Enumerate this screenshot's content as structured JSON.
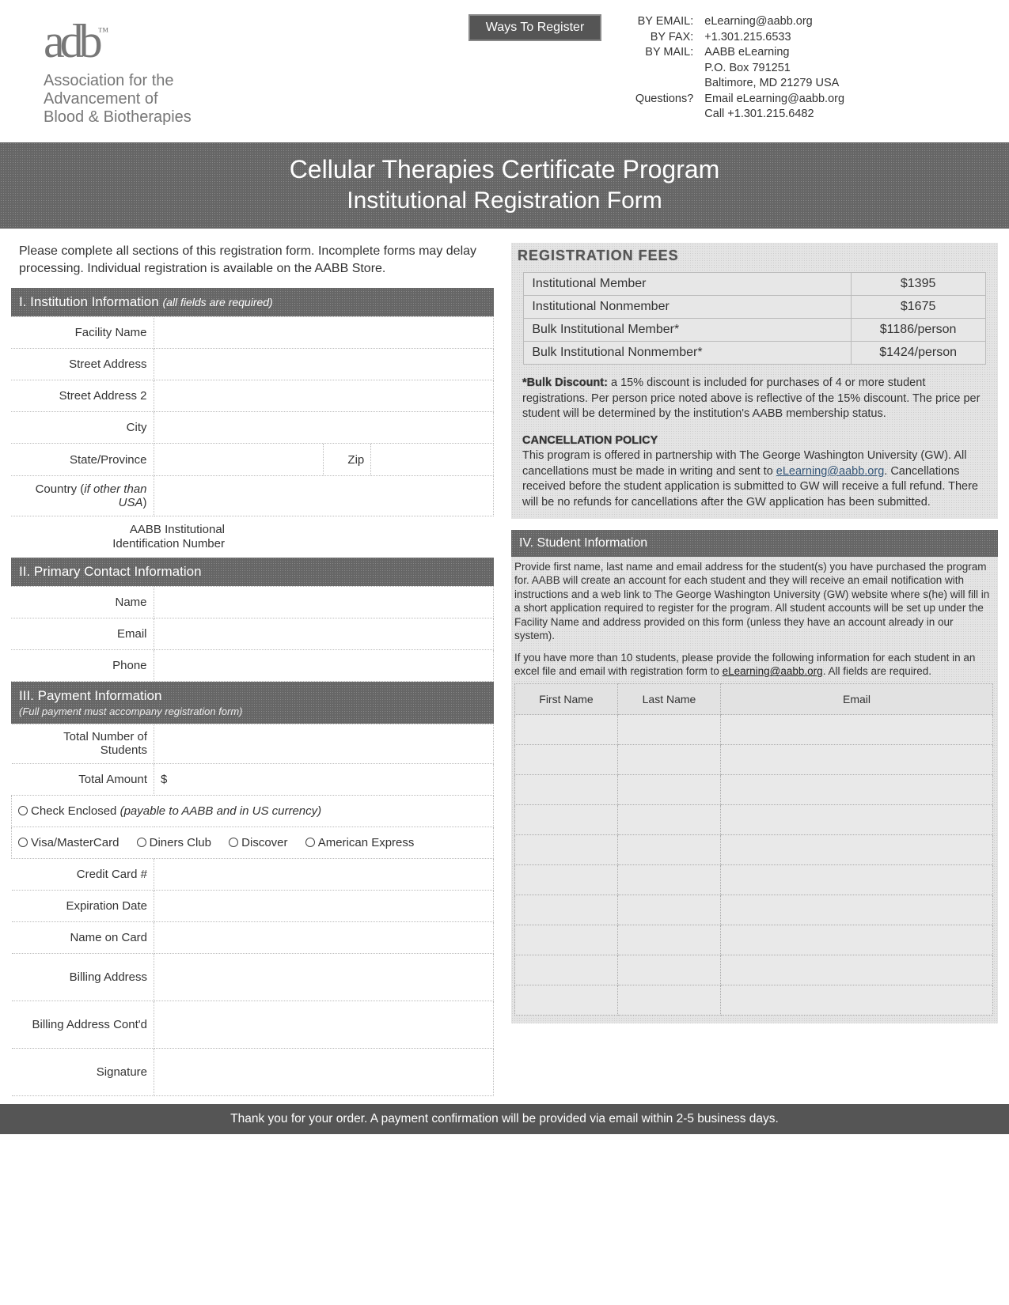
{
  "header": {
    "org_line1": "Association for the",
    "org_line2": "Advancement of",
    "org_line3": "Blood & Biotherapies",
    "ways_btn": "Ways To Register",
    "contact": {
      "email_lbl": "BY EMAIL:",
      "email_val": "eLearning@aabb.org",
      "fax_lbl": "BY FAX:",
      "fax_val": "+1.301.215.6533",
      "mail_lbl": "BY MAIL:",
      "mail_val1": "AABB eLearning",
      "mail_val2": "P.O. Box 791251",
      "mail_val3": "Baltimore, MD 21279 USA",
      "q_lbl": "Questions?",
      "q_val1": "Email eLearning@aabb.org",
      "q_val2": "Call +1.301.215.6482"
    }
  },
  "title": {
    "line1": "Cellular Therapies Certificate Program",
    "line2": "Institutional Registration Form"
  },
  "intro": "Please complete all sections of this registration form. Incomplete forms may delay processing. Individual registration is available on the AABB Store.",
  "sec1": {
    "head": "I. Institution Information",
    "head_note": "(all fields are required)",
    "labels": {
      "facility": "Facility Name",
      "street1": "Street Address",
      "street2": "Street Address 2",
      "city": "City",
      "state": "State/Province",
      "zip": "Zip",
      "country": "Country (if other than USA)",
      "aabb_id": "AABB Institutional Identification Number"
    }
  },
  "sec2": {
    "head": "II. Primary Contact Information",
    "labels": {
      "name": "Name",
      "email": "Email",
      "phone": "Phone"
    }
  },
  "sec3": {
    "head": "III. Payment Information",
    "sub": "(Full payment must accompany registration form)",
    "labels": {
      "total_students": "Total Number of Students",
      "total_amount": "Total Amount",
      "amount_prefix": "$",
      "check": "Check Enclosed",
      "check_note": "(payable to AABB and in US currency)",
      "visa": "Visa/MasterCard",
      "diners": "Diners Club",
      "discover": "Discover",
      "amex": "American Express",
      "cc": "Credit Card #",
      "exp": "Expiration Date",
      "name_on_card": "Name on Card",
      "billing": "Billing Address",
      "billing2": "Billing Address Cont'd",
      "sig": "Signature"
    }
  },
  "fees": {
    "head": "REGISTRATION FEES",
    "rows": [
      {
        "label": "Institutional Member",
        "amount": "$1395"
      },
      {
        "label": "Institutional Nonmember",
        "amount": "$1675"
      },
      {
        "label": "Bulk Institutional Member*",
        "amount": "$1186/person"
      },
      {
        "label": "Bulk Institutional Nonmember*",
        "amount": "$1424/person"
      }
    ],
    "bulk_head": "*Bulk Discount:",
    "bulk_text": " a 15% discount is included for purchases of 4 or more student registrations. Per person price noted above is reflective of the 15% discount. The price per student will be determined by the institution's AABB membership status.",
    "cancel_head": "CANCELLATION POLICY",
    "cancel_text_a": "This program is offered in partnership with The George Washington University (GW). All cancellations must be made in writing and sent to ",
    "cancel_link": "eLearning@aabb.org",
    "cancel_text_b": ". Cancellations received before the student application is submitted to GW will receive a full refund. There will be no refunds for cancellations after the GW application has been submitted."
  },
  "sec4": {
    "head": "IV. Student Information",
    "intro1": "Provide first name, last name and email address for the student(s) you have purchased the program for. AABB will create an account for each student and they will receive an email notification with instructions and a web link to The George Washington University (GW) website where s(he) will fill in a short application required to register for the program. All student accounts will be set up under the Facility Name and address provided on this form (unless they have an account already in our system).",
    "intro2_a": "If you have more than 10 students, please provide the following information for each student in an excel file and email with registration form to ",
    "intro2_link": "eLearning@aabb.org",
    "intro2_b": ". All fields are required.",
    "cols": {
      "first": "First Name",
      "last": "Last Name",
      "email": "Email"
    }
  },
  "footer": "Thank you for your order. A payment confirmation will be provided via email within 2-5 business days."
}
